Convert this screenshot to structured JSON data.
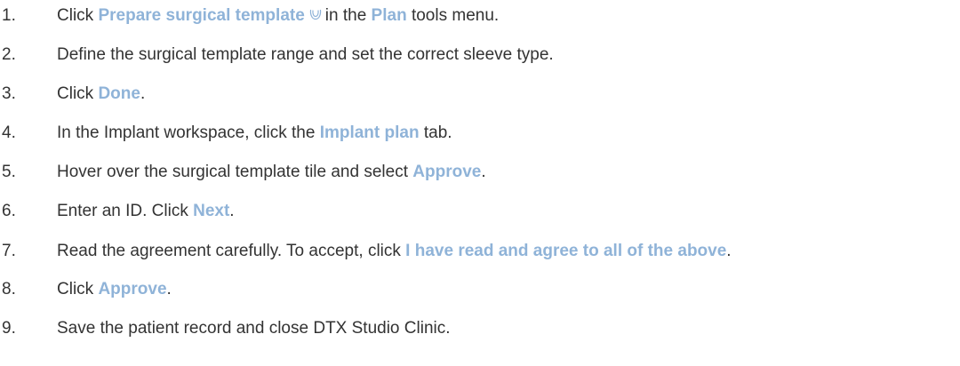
{
  "steps": [
    {
      "num": "1.",
      "parts": [
        {
          "t": "Click ",
          "hl": false
        },
        {
          "t": "Prepare surgical template",
          "hl": true
        },
        {
          "icon": "surgical-template-icon"
        },
        {
          "t": "in the ",
          "hl": false
        },
        {
          "t": "Plan",
          "hl": true
        },
        {
          "t": " tools menu.",
          "hl": false
        }
      ]
    },
    {
      "num": "2.",
      "parts": [
        {
          "t": "Define the surgical template range and set the correct sleeve type.",
          "hl": false
        }
      ]
    },
    {
      "num": "3.",
      "parts": [
        {
          "t": "Click ",
          "hl": false
        },
        {
          "t": "Done",
          "hl": true
        },
        {
          "t": ".",
          "hl": false
        }
      ]
    },
    {
      "num": "4.",
      "parts": [
        {
          "t": "In the Implant workspace, click the ",
          "hl": false
        },
        {
          "t": "Implant plan",
          "hl": true
        },
        {
          "t": " tab.",
          "hl": false
        }
      ]
    },
    {
      "num": "5.",
      "parts": [
        {
          "t": "Hover over the surgical template tile and select ",
          "hl": false
        },
        {
          "t": "Approve",
          "hl": true
        },
        {
          "t": ".",
          "hl": false
        }
      ]
    },
    {
      "num": "6.",
      "parts": [
        {
          "t": "Enter an ID. Click ",
          "hl": false
        },
        {
          "t": "Next",
          "hl": true
        },
        {
          "t": ".",
          "hl": false
        }
      ]
    },
    {
      "num": "7.",
      "parts": [
        {
          "t": "Read the agreement carefully. To accept, click ",
          "hl": false
        },
        {
          "t": "I have read and agree to all of the above",
          "hl": true
        },
        {
          "t": ".",
          "hl": false
        }
      ]
    },
    {
      "num": "8.",
      "parts": [
        {
          "t": "Click ",
          "hl": false
        },
        {
          "t": "Approve",
          "hl": true
        },
        {
          "t": ".",
          "hl": false
        }
      ]
    },
    {
      "num": "9.",
      "parts": [
        {
          "t": "Save the patient record and close DTX Studio Clinic.",
          "hl": false
        }
      ]
    }
  ],
  "colors": {
    "text": "#333333",
    "highlight": "#8fb3d8"
  }
}
